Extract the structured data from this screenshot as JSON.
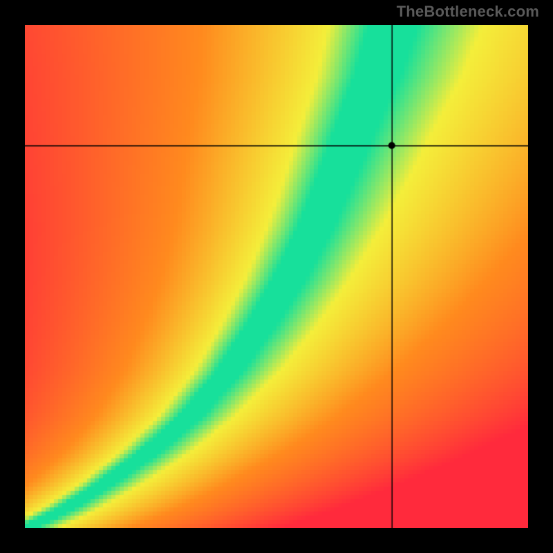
{
  "watermark": "TheBottleneck.com",
  "chart_data": {
    "type": "heatmap",
    "title": "",
    "xlabel": "",
    "ylabel": "",
    "xlim": [
      0,
      1
    ],
    "ylim": [
      0,
      1
    ],
    "crosshair": {
      "x": 0.73,
      "y": 0.76
    },
    "marker": {
      "x": 0.73,
      "y": 0.76
    },
    "ridge_curve": [
      {
        "x": 0.0,
        "y": 0.0
      },
      {
        "x": 0.08,
        "y": 0.04
      },
      {
        "x": 0.16,
        "y": 0.09
      },
      {
        "x": 0.24,
        "y": 0.15
      },
      {
        "x": 0.32,
        "y": 0.22
      },
      {
        "x": 0.4,
        "y": 0.31
      },
      {
        "x": 0.46,
        "y": 0.4
      },
      {
        "x": 0.52,
        "y": 0.5
      },
      {
        "x": 0.57,
        "y": 0.6
      },
      {
        "x": 0.61,
        "y": 0.7
      },
      {
        "x": 0.65,
        "y": 0.8
      },
      {
        "x": 0.69,
        "y": 0.9
      },
      {
        "x": 0.72,
        "y": 1.0
      }
    ],
    "ridge_width": 0.07,
    "colors": {
      "ridge": "#17e09b",
      "near": "#f4ee3a",
      "mid": "#ff8a1e",
      "far": "#ff2a3c"
    },
    "grid": false,
    "legend": false
  }
}
